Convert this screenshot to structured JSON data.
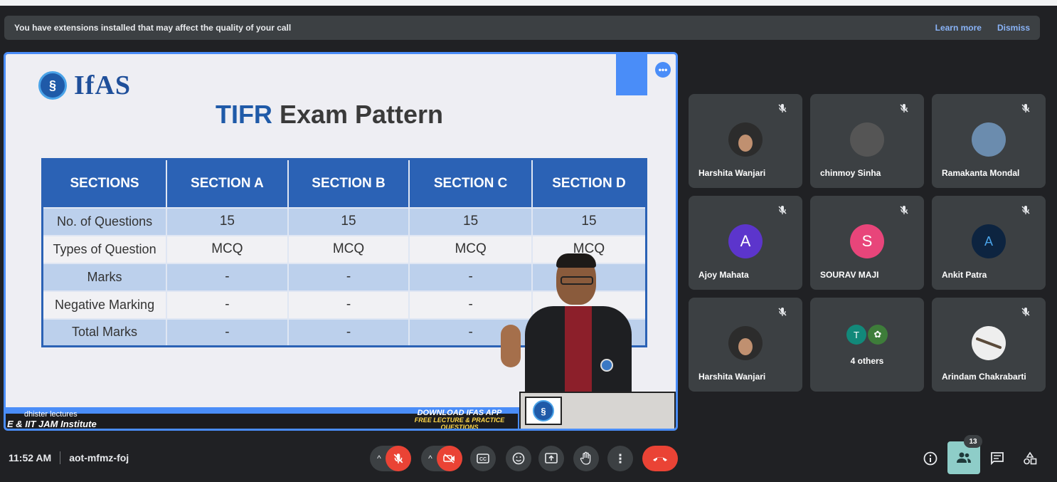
{
  "banner": {
    "message": "You have extensions installed that may affect the quality of your call",
    "learn_more": "Learn more",
    "dismiss": "Dismiss"
  },
  "slide": {
    "logo_text": "IfAS",
    "title_accent": "TIFR",
    "title_rest": "Exam Pattern",
    "table": {
      "headers": [
        "SECTIONS",
        "SECTION A",
        "SECTION B",
        "SECTION C",
        "SECTION D"
      ],
      "rows": [
        [
          "No. of Questions",
          "15",
          "15",
          "15",
          "15"
        ],
        [
          "Types of Question",
          "MCQ",
          "MCQ",
          "MCQ",
          "MCQ"
        ],
        [
          "Marks",
          "-",
          "-",
          "-",
          ""
        ],
        [
          "Negative Marking",
          "-",
          "-",
          "-",
          ""
        ],
        [
          "Total Marks",
          "-",
          "-",
          "-",
          ""
        ]
      ]
    },
    "presenter_name": "dhister lectures",
    "institute": "E & IIT JAM Institute",
    "download_line1": "DOWNLOAD IFAS APP",
    "download_line2": "FREE LECTURE & PRACTICE QUESTIONS"
  },
  "participants": [
    {
      "name": "Harshita Wanjari",
      "avatar": "photo"
    },
    {
      "name": "chinmoy Sinha",
      "avatar": "photo"
    },
    {
      "name": "Ramakanta Mondal",
      "avatar": "photo"
    },
    {
      "name": "Ajoy Mahata",
      "avatar": "A",
      "color": "#5c35cc"
    },
    {
      "name": "SOURAV MAJI",
      "avatar": "S",
      "color": "#e8457a"
    },
    {
      "name": "Ankit Patra",
      "avatar": "A",
      "color": "#0d2440"
    },
    {
      "name": "Harshita Wanjari",
      "avatar": "photo"
    },
    {
      "others_label": "4 others",
      "mini_initial": "T",
      "mini_color": "#12897a"
    },
    {
      "name": "Arindam Chakrabarti",
      "avatar": "photo"
    }
  ],
  "bottom": {
    "time": "11:52 AM",
    "meeting_code": "aot-mfmz-foj",
    "people_count": "13"
  },
  "icons": [
    "mic-off-icon",
    "camera-off-icon",
    "captions-icon",
    "emoji-icon",
    "present-icon",
    "raise-hand-icon",
    "more-options-icon",
    "hangup-icon",
    "info-icon",
    "people-icon",
    "chat-icon",
    "activities-icon"
  ],
  "colors": {
    "accent": "#8ab4f8",
    "danger": "#ea4335",
    "tile": "#3c4043",
    "background": "#202124",
    "slide_blue": "#2b62b5"
  }
}
